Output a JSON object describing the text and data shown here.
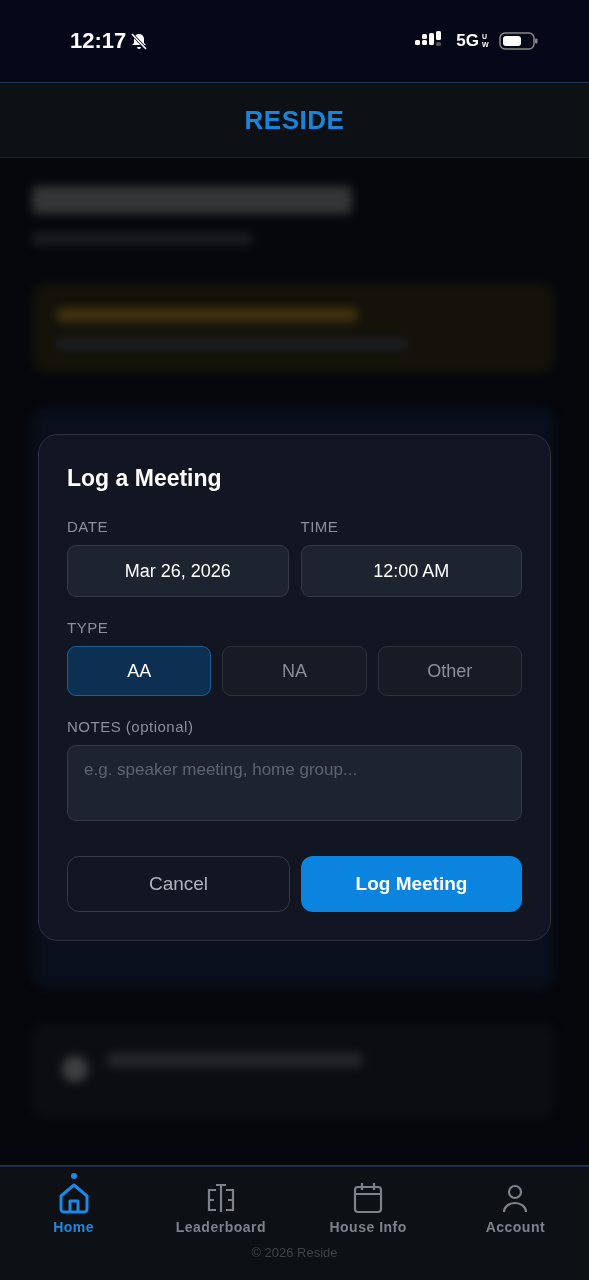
{
  "status_bar": {
    "time": "12:17",
    "network": "5G",
    "network_badge": "UW"
  },
  "header": {
    "logo": "RESIDE"
  },
  "dialog": {
    "title": "Log a Meeting",
    "date": {
      "label": "DATE",
      "value": "Mar 26, 2026"
    },
    "time": {
      "label": "TIME",
      "value": "12:00 AM"
    },
    "type": {
      "label": "TYPE",
      "options": [
        {
          "label": "AA",
          "selected": true
        },
        {
          "label": "NA",
          "selected": false
        },
        {
          "label": "Other",
          "selected": false
        }
      ]
    },
    "notes": {
      "label": "NOTES (optional)",
      "placeholder": "e.g. speaker meeting, home group..."
    },
    "buttons": [
      {
        "label": "Cancel",
        "kind": "secondary"
      },
      {
        "label": "Log Meeting",
        "kind": "primary"
      }
    ]
  },
  "tab_bar": {
    "items": [
      {
        "label": "Home",
        "kind": "home",
        "selected": true
      },
      {
        "label": "Leaderboard",
        "kind": "leaderboard",
        "selected": false
      },
      {
        "label": "House Info",
        "kind": "calendar",
        "selected": false
      },
      {
        "label": "Account",
        "kind": "account",
        "selected": false
      }
    ],
    "footer": "© 2026 Reside"
  }
}
